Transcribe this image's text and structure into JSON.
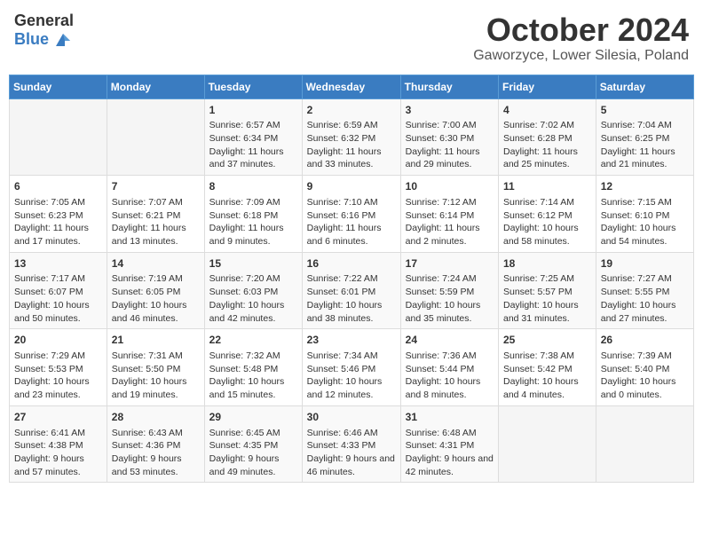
{
  "header": {
    "logo": {
      "general": "General",
      "blue": "Blue"
    },
    "title": "October 2024",
    "subtitle": "Gaworzyce, Lower Silesia, Poland"
  },
  "calendar": {
    "days_of_week": [
      "Sunday",
      "Monday",
      "Tuesday",
      "Wednesday",
      "Thursday",
      "Friday",
      "Saturday"
    ],
    "weeks": [
      [
        {
          "day": "",
          "info": ""
        },
        {
          "day": "",
          "info": ""
        },
        {
          "day": "1",
          "info": "Sunrise: 6:57 AM\nSunset: 6:34 PM\nDaylight: 11 hours and 37 minutes."
        },
        {
          "day": "2",
          "info": "Sunrise: 6:59 AM\nSunset: 6:32 PM\nDaylight: 11 hours and 33 minutes."
        },
        {
          "day": "3",
          "info": "Sunrise: 7:00 AM\nSunset: 6:30 PM\nDaylight: 11 hours and 29 minutes."
        },
        {
          "day": "4",
          "info": "Sunrise: 7:02 AM\nSunset: 6:28 PM\nDaylight: 11 hours and 25 minutes."
        },
        {
          "day": "5",
          "info": "Sunrise: 7:04 AM\nSunset: 6:25 PM\nDaylight: 11 hours and 21 minutes."
        }
      ],
      [
        {
          "day": "6",
          "info": "Sunrise: 7:05 AM\nSunset: 6:23 PM\nDaylight: 11 hours and 17 minutes."
        },
        {
          "day": "7",
          "info": "Sunrise: 7:07 AM\nSunset: 6:21 PM\nDaylight: 11 hours and 13 minutes."
        },
        {
          "day": "8",
          "info": "Sunrise: 7:09 AM\nSunset: 6:18 PM\nDaylight: 11 hours and 9 minutes."
        },
        {
          "day": "9",
          "info": "Sunrise: 7:10 AM\nSunset: 6:16 PM\nDaylight: 11 hours and 6 minutes."
        },
        {
          "day": "10",
          "info": "Sunrise: 7:12 AM\nSunset: 6:14 PM\nDaylight: 11 hours and 2 minutes."
        },
        {
          "day": "11",
          "info": "Sunrise: 7:14 AM\nSunset: 6:12 PM\nDaylight: 10 hours and 58 minutes."
        },
        {
          "day": "12",
          "info": "Sunrise: 7:15 AM\nSunset: 6:10 PM\nDaylight: 10 hours and 54 minutes."
        }
      ],
      [
        {
          "day": "13",
          "info": "Sunrise: 7:17 AM\nSunset: 6:07 PM\nDaylight: 10 hours and 50 minutes."
        },
        {
          "day": "14",
          "info": "Sunrise: 7:19 AM\nSunset: 6:05 PM\nDaylight: 10 hours and 46 minutes."
        },
        {
          "day": "15",
          "info": "Sunrise: 7:20 AM\nSunset: 6:03 PM\nDaylight: 10 hours and 42 minutes."
        },
        {
          "day": "16",
          "info": "Sunrise: 7:22 AM\nSunset: 6:01 PM\nDaylight: 10 hours and 38 minutes."
        },
        {
          "day": "17",
          "info": "Sunrise: 7:24 AM\nSunset: 5:59 PM\nDaylight: 10 hours and 35 minutes."
        },
        {
          "day": "18",
          "info": "Sunrise: 7:25 AM\nSunset: 5:57 PM\nDaylight: 10 hours and 31 minutes."
        },
        {
          "day": "19",
          "info": "Sunrise: 7:27 AM\nSunset: 5:55 PM\nDaylight: 10 hours and 27 minutes."
        }
      ],
      [
        {
          "day": "20",
          "info": "Sunrise: 7:29 AM\nSunset: 5:53 PM\nDaylight: 10 hours and 23 minutes."
        },
        {
          "day": "21",
          "info": "Sunrise: 7:31 AM\nSunset: 5:50 PM\nDaylight: 10 hours and 19 minutes."
        },
        {
          "day": "22",
          "info": "Sunrise: 7:32 AM\nSunset: 5:48 PM\nDaylight: 10 hours and 15 minutes."
        },
        {
          "day": "23",
          "info": "Sunrise: 7:34 AM\nSunset: 5:46 PM\nDaylight: 10 hours and 12 minutes."
        },
        {
          "day": "24",
          "info": "Sunrise: 7:36 AM\nSunset: 5:44 PM\nDaylight: 10 hours and 8 minutes."
        },
        {
          "day": "25",
          "info": "Sunrise: 7:38 AM\nSunset: 5:42 PM\nDaylight: 10 hours and 4 minutes."
        },
        {
          "day": "26",
          "info": "Sunrise: 7:39 AM\nSunset: 5:40 PM\nDaylight: 10 hours and 0 minutes."
        }
      ],
      [
        {
          "day": "27",
          "info": "Sunrise: 6:41 AM\nSunset: 4:38 PM\nDaylight: 9 hours and 57 minutes."
        },
        {
          "day": "28",
          "info": "Sunrise: 6:43 AM\nSunset: 4:36 PM\nDaylight: 9 hours and 53 minutes."
        },
        {
          "day": "29",
          "info": "Sunrise: 6:45 AM\nSunset: 4:35 PM\nDaylight: 9 hours and 49 minutes."
        },
        {
          "day": "30",
          "info": "Sunrise: 6:46 AM\nSunset: 4:33 PM\nDaylight: 9 hours and 46 minutes."
        },
        {
          "day": "31",
          "info": "Sunrise: 6:48 AM\nSunset: 4:31 PM\nDaylight: 9 hours and 42 minutes."
        },
        {
          "day": "",
          "info": ""
        },
        {
          "day": "",
          "info": ""
        }
      ]
    ]
  }
}
